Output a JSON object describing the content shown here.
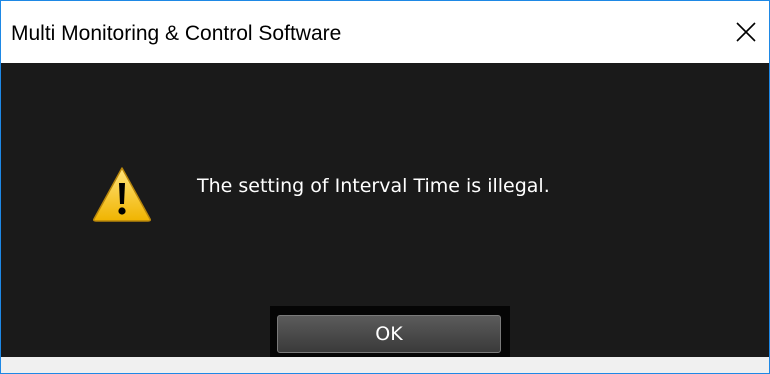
{
  "window": {
    "title": "Multi Monitoring & Control Software",
    "close_symbol": "✕"
  },
  "dialog": {
    "icon": "warning-icon",
    "message": "The setting of Interval Time is illegal.",
    "ok_label": "OK"
  },
  "colors": {
    "accent_border": "#1e88e5",
    "body_background": "#1a1a1a",
    "warning_yellow": "#f5c518"
  }
}
